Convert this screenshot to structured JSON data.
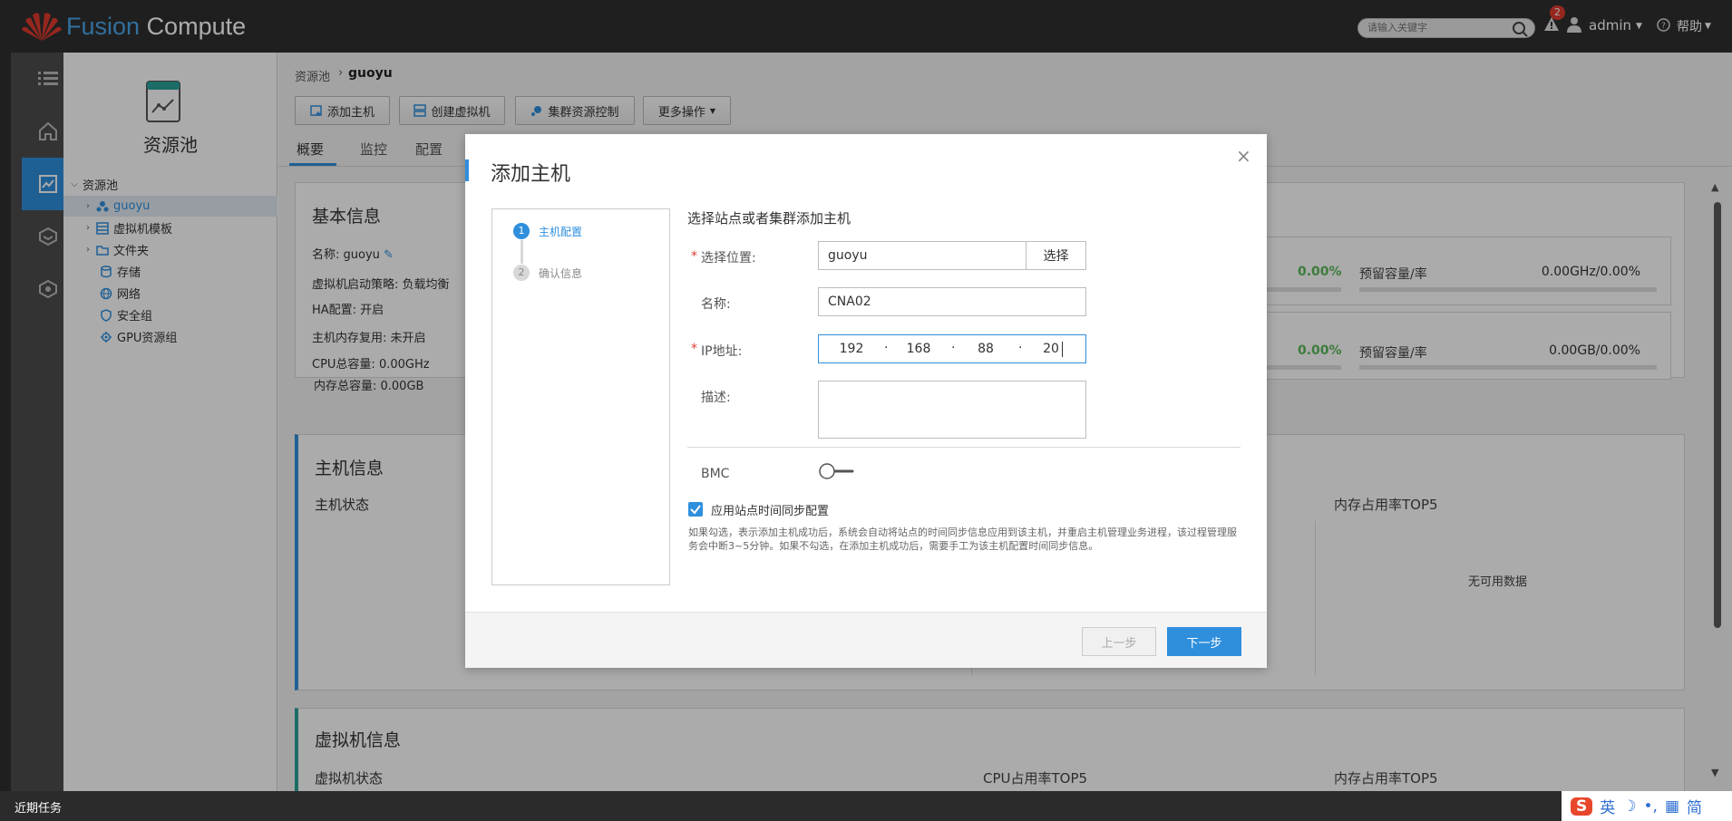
{
  "app": {
    "brand_part1": "Fusion",
    "brand_part2": "Compute"
  },
  "header": {
    "search_placeholder": "请输入关键字",
    "alarm_count": "2",
    "user": "admin",
    "help": "帮助"
  },
  "rail": {
    "items": [
      "menu-icon",
      "home-icon",
      "resource-pool-icon",
      "network-icon",
      "security-icon"
    ],
    "active_index": 2
  },
  "tree": {
    "title": "资源池",
    "root": "资源池",
    "items": [
      {
        "label": "guoyu",
        "icon": "cluster-icon",
        "expandable": true,
        "selected": true
      },
      {
        "label": "虚拟机模板",
        "icon": "template-icon",
        "expandable": true
      },
      {
        "label": "文件夹",
        "icon": "folder-icon",
        "expandable": true
      },
      {
        "label": "存储",
        "icon": "storage-icon",
        "expandable": false
      },
      {
        "label": "网络",
        "icon": "network-icon",
        "expandable": false
      },
      {
        "label": "安全组",
        "icon": "security-group-icon",
        "expandable": false
      },
      {
        "label": "GPU资源组",
        "icon": "gpu-icon",
        "expandable": false
      }
    ]
  },
  "main": {
    "breadcrumb": {
      "root": "资源池",
      "sep": "›",
      "current": "guoyu"
    },
    "toolbar": {
      "add_host": "添加主机",
      "create_vm": "创建虚拟机",
      "cluster_ctrl": "集群资源控制",
      "more": "更多操作"
    },
    "tabs": [
      "概要",
      "监控",
      "配置"
    ],
    "basic": {
      "title": "基本信息",
      "name_label": "名称: guoyu",
      "policy": "虚拟机启动策略: 负载均衡",
      "ha": "HA配置: 开启",
      "mem_reuse": "主机内存复用: 未开启",
      "cpu_total": "CPU总容量: 0.00GHz",
      "mem_total": "内存总容量: 0.00GB",
      "cpu_pct": "0.00%",
      "cpu_reserve_label": "预留容量/率",
      "cpu_reserve_val": "0.00GHz/0.00%",
      "mem_pct": "0.00%",
      "mem_reserve_label": "预留容量/率",
      "mem_reserve_val": "0.00GB/0.00%"
    },
    "host": {
      "title": "主机信息",
      "status": "主机状态",
      "mem_top5": "内存占用率TOP5",
      "no_data": "无可用数据"
    },
    "vm": {
      "title": "虚拟机信息",
      "status": "虚拟机状态",
      "cpu_top5": "CPU占用率TOP5",
      "mem_top5": "内存占用率TOP5"
    }
  },
  "modal": {
    "title": "添加主机",
    "close": "×",
    "steps": [
      {
        "num": "1",
        "label": "主机配置"
      },
      {
        "num": "2",
        "label": "确认信息"
      }
    ],
    "form_head": "选择站点或者集群添加主机",
    "location_label": "选择位置:",
    "location_value": "guoyu",
    "location_btn": "选择",
    "name_label": "名称:",
    "name_value": "CNA02",
    "ip_label": "IP地址:",
    "ip": [
      "192",
      "168",
      "88",
      "20"
    ],
    "ip_dot": "·",
    "desc_label": "描述:",
    "bmc_label": "BMC",
    "sync_label": "应用站点时间同步配置",
    "sync_note": "如果勾选，表示添加主机成功后，系统会自动将站点的时间同步信息应用到该主机，并重启主机管理业务进程，该过程管理服务会中断3~5分钟。如果不勾选，在添加主机成功后，需要手工为该主机配置时间同步信息。",
    "prev": "上一步",
    "next": "下一步"
  },
  "taskbar": {
    "label": "近期任务",
    "ime": [
      "S",
      "英",
      "☽",
      "•,",
      "▦",
      "简"
    ]
  }
}
